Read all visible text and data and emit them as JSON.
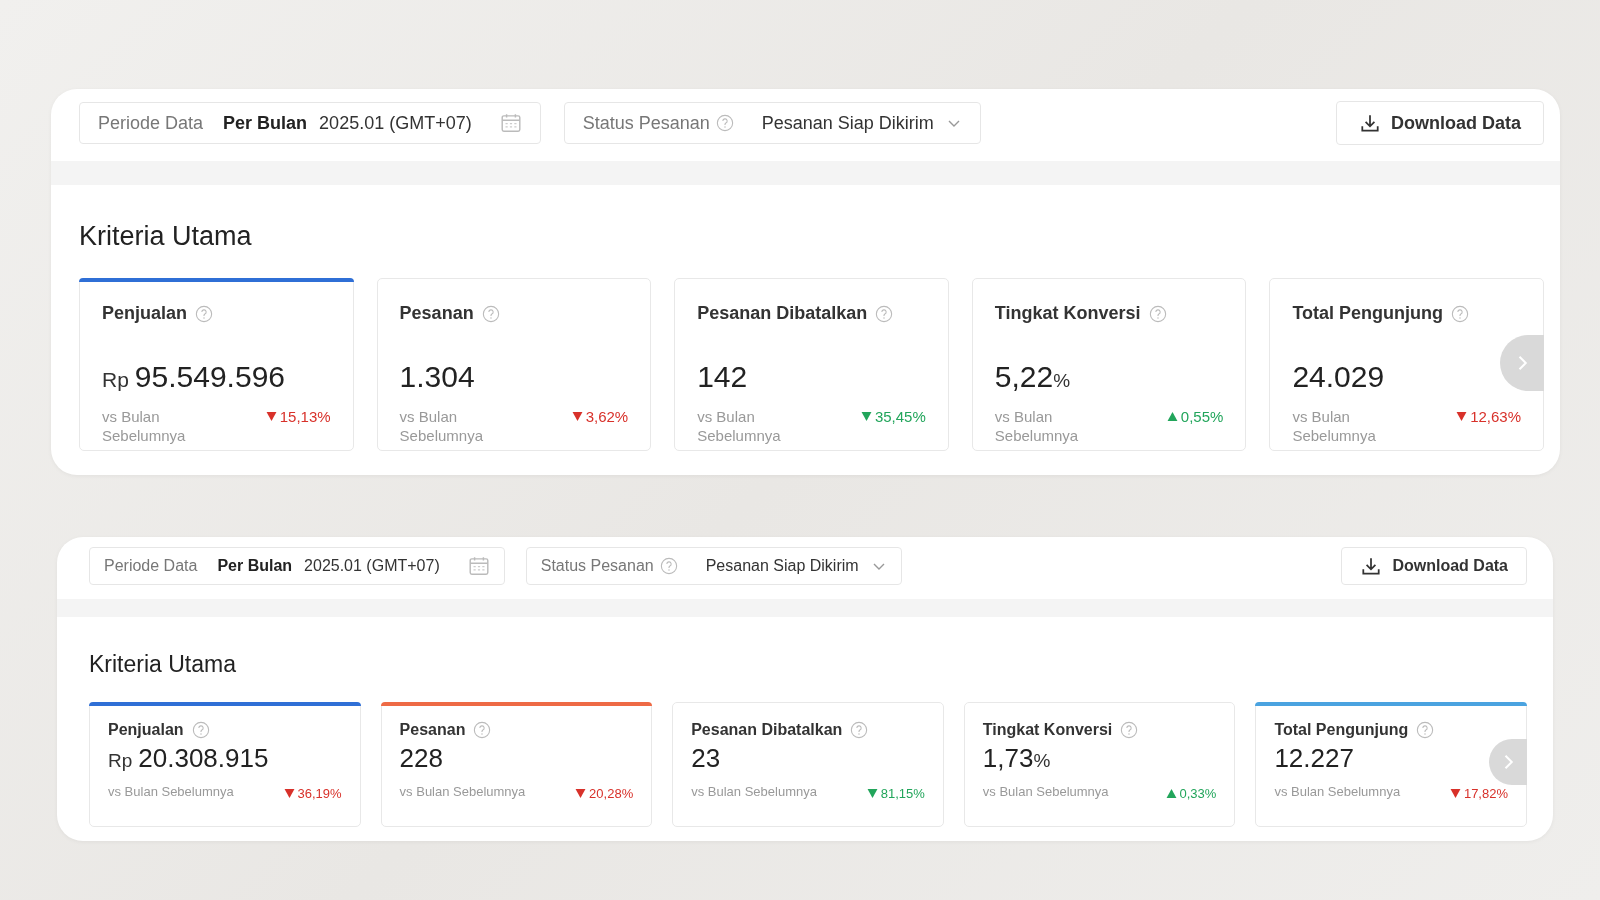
{
  "panels": [
    {
      "filters": {
        "period_label": "Periode Data",
        "period_mode": "Per Bulan",
        "period_value": "2025.01 (GMT+07)",
        "status_label": "Status Pesanan",
        "status_value": "Pesanan Siap Dikirim"
      },
      "download_button": "Download Data",
      "section_title": "Kriteria Utama",
      "cards": [
        {
          "title": "Penjualan",
          "prefix": "Rp",
          "value": "95.549.596",
          "comparison": "vs Bulan Sebelumnya",
          "change": "15,13%",
          "increase": false,
          "good": false,
          "selected": true,
          "color": "#2f6fd6"
        },
        {
          "title": "Pesanan",
          "value": "1.304",
          "comparison": "vs Bulan Sebelumnya",
          "change": "3,62%",
          "increase": false,
          "good": false,
          "selected": false
        },
        {
          "title": "Pesanan Dibatalkan",
          "value": "142",
          "comparison": "vs Bulan Sebelumnya",
          "change": "35,45%",
          "increase": false,
          "good": true,
          "selected": false
        },
        {
          "title": "Tingkat Konversi",
          "value": "5,22",
          "suffix": "%",
          "comparison": "vs Bulan Sebelumnya",
          "change": "0,55%",
          "increase": true,
          "good": true,
          "selected": false
        },
        {
          "title": "Total Pengunjung",
          "value": "24.029",
          "comparison": "vs Bulan Sebelumnya",
          "change": "12,63%",
          "increase": false,
          "good": false,
          "selected": false
        }
      ]
    },
    {
      "filters": {
        "period_label": "Periode Data",
        "period_mode": "Per Bulan",
        "period_value": "2025.01 (GMT+07)",
        "status_label": "Status Pesanan",
        "status_value": "Pesanan Siap Dikirim"
      },
      "download_button": "Download Data",
      "section_title": "Kriteria Utama",
      "cards": [
        {
          "title": "Penjualan",
          "prefix": "Rp",
          "value": "20.308.915",
          "comparison": "vs Bulan Sebelumnya",
          "change": "36,19%",
          "increase": false,
          "good": false,
          "selected": true,
          "color": "#2f6fd6"
        },
        {
          "title": "Pesanan",
          "value": "228",
          "comparison": "vs Bulan Sebelumnya",
          "change": "20,28%",
          "increase": false,
          "good": false,
          "selected": true,
          "color": "#ee6a45"
        },
        {
          "title": "Pesanan Dibatalkan",
          "value": "23",
          "comparison": "vs Bulan Sebelumnya",
          "change": "81,15%",
          "increase": false,
          "good": true,
          "selected": false
        },
        {
          "title": "Tingkat Konversi",
          "value": "1,73",
          "suffix": "%",
          "comparison": "vs Bulan Sebelumnya",
          "change": "0,33%",
          "increase": true,
          "good": true,
          "selected": false
        },
        {
          "title": "Total Pengunjung",
          "value": "12.227",
          "comparison": "vs Bulan Sebelumnya",
          "change": "17,82%",
          "increase": false,
          "good": false,
          "selected": true,
          "color": "#4aa3e0"
        }
      ]
    }
  ]
}
